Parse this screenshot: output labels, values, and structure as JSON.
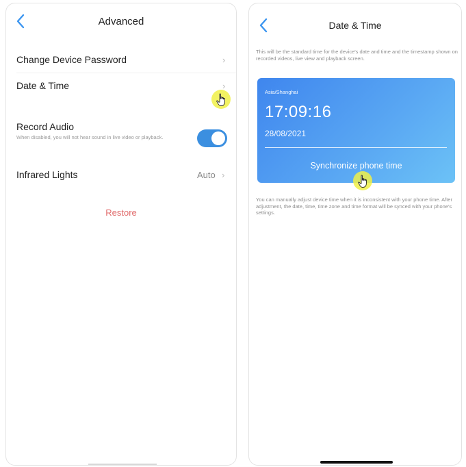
{
  "left_screen": {
    "title": "Advanced",
    "items": [
      {
        "label": "Change Device Password",
        "chevron": "›"
      },
      {
        "label": "Date & Time",
        "chevron": "›"
      },
      {
        "label": "Record Audio",
        "sub": "When disabled, you will not hear sound in live video or playback.",
        "toggle": "on"
      },
      {
        "label": "Infrared Lights",
        "value": "Auto",
        "chevron": "›"
      }
    ],
    "restore_label": "Restore"
  },
  "right_screen": {
    "title": "Date & Time",
    "description": "This will be the standard time for the device's date and time and the timestamp shown on recorded videos, live view and playback screen.",
    "card": {
      "timezone": "Asia/Shanghai",
      "time": "17:09:16",
      "date": "28/08/2021",
      "sync_label": "Synchronize phone time"
    },
    "footer_note": "You can manually adjust device time when it is inconsistent with your phone time. After adjustment, the date, time, time zone and time format will be synced with your phone's settings."
  },
  "colors": {
    "accent": "#3b95f0",
    "toggle_on": "#3b8fe0",
    "restore": "#e06a6a",
    "card_start": "#3f86ee",
    "card_end": "#6cc2f6",
    "cursor_highlight": "#f0f046"
  },
  "icons": [
    "back-chevron-icon",
    "chevron-right-icon",
    "hand-pointer-icon"
  ]
}
